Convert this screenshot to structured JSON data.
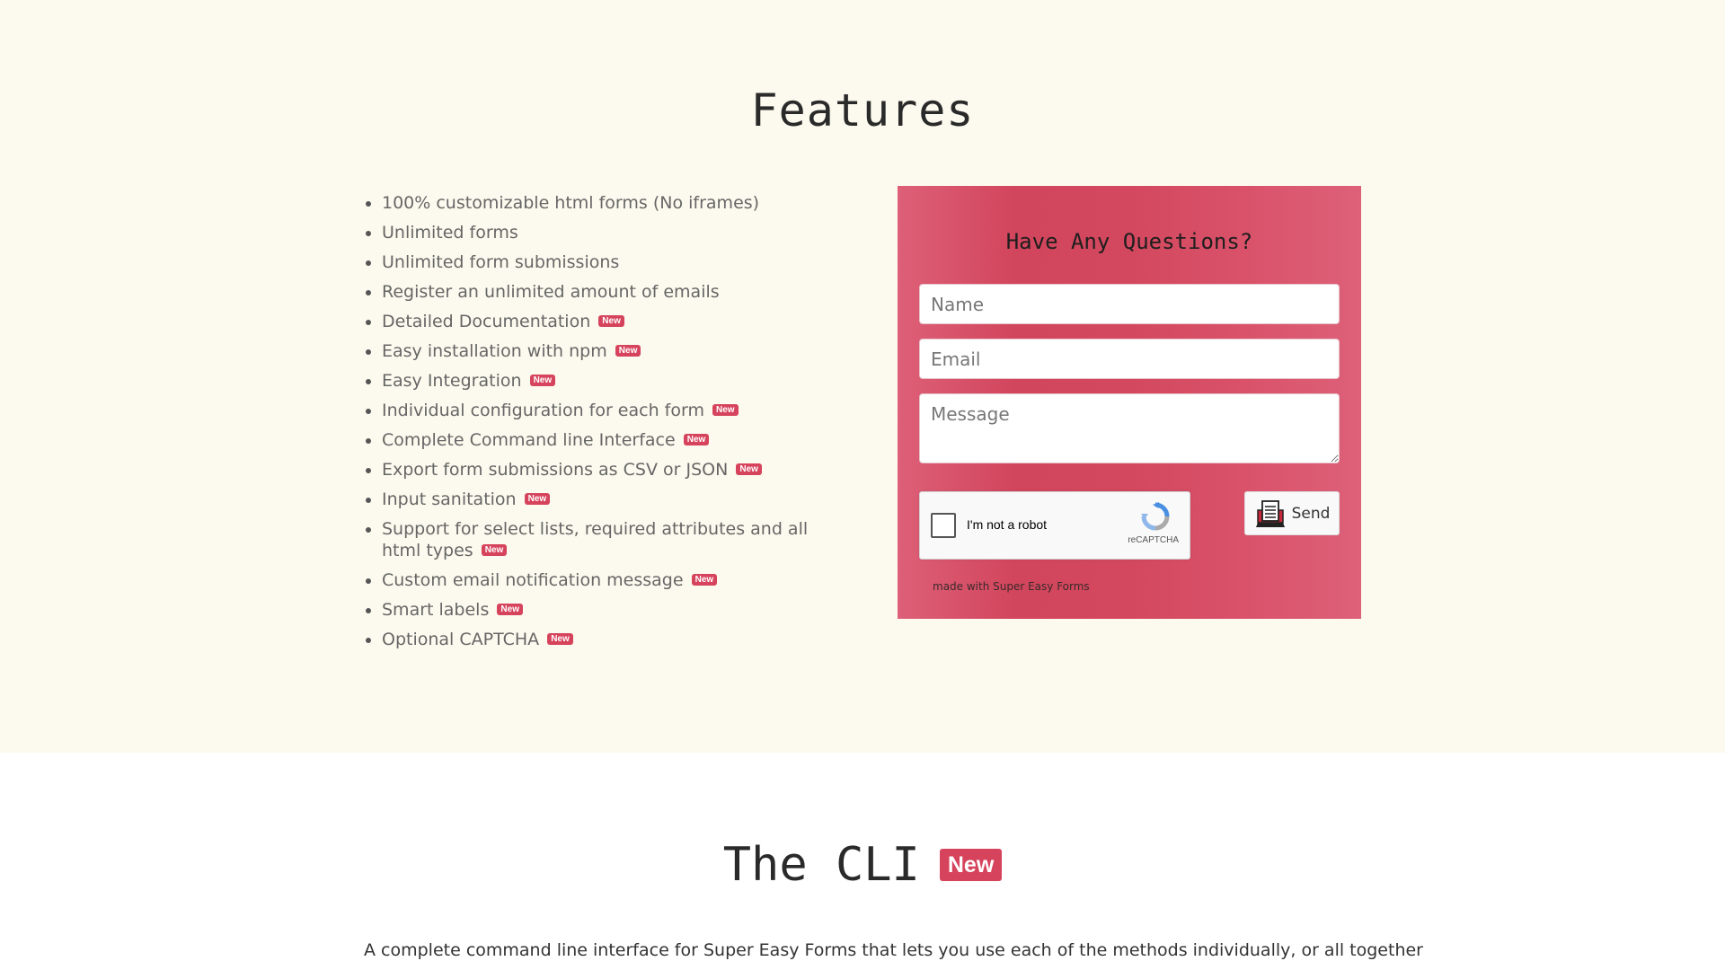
{
  "features_section": {
    "title": "Features",
    "badge_label": "New",
    "items": [
      {
        "text": "100% customizable html forms (No iframes)",
        "badge": ""
      },
      {
        "text": "Unlimited forms",
        "badge": ""
      },
      {
        "text": "Unlimited form submissions",
        "badge": ""
      },
      {
        "text": "Register an unlimited amount of emails",
        "badge": ""
      },
      {
        "text": "Detailed Documentation",
        "badge": "New"
      },
      {
        "text": "Easy installation with npm",
        "badge": "New"
      },
      {
        "text": "Easy Integration",
        "badge": "New"
      },
      {
        "text": "Individual configuration for each form",
        "badge": "New"
      },
      {
        "text": "Complete Command line Interface",
        "badge": "New"
      },
      {
        "text": "Export form submissions as CSV or JSON",
        "badge": "New"
      },
      {
        "text": "Input sanitation",
        "badge": "New"
      },
      {
        "text": "Support for select lists, required attributes and all html types",
        "badge": "New"
      },
      {
        "text": "Custom email notification message",
        "badge": "New"
      },
      {
        "text": "Smart labels",
        "badge": "New"
      },
      {
        "text": "Optional CAPTCHA",
        "badge": "New"
      }
    ]
  },
  "contact_form": {
    "title": "Have Any Questions?",
    "name_placeholder": "Name",
    "email_placeholder": "Email",
    "message_placeholder": "Message",
    "captcha_label": "I'm not a robot",
    "captcha_brand": "reCAPTCHA",
    "send_label": "Send",
    "made_with": "made with Super Easy Forms",
    "panel_colors": [
      "#dd6078",
      "#d2465d",
      "#dd6179"
    ]
  },
  "cli_section": {
    "title": "The CLI",
    "badge": "New",
    "description": "A complete command line interface for Super Easy Forms that lets you use each of the methods individually, or all together"
  },
  "colors": {
    "page_background": "#fcfaee",
    "badge": "#d6435c"
  }
}
